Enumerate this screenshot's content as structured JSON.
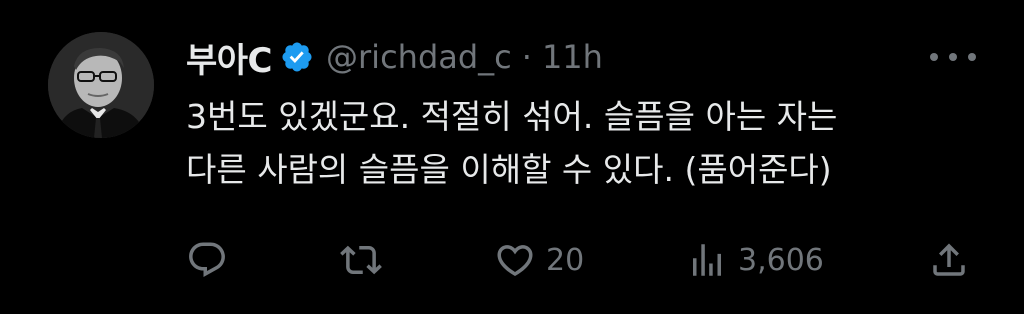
{
  "tweet": {
    "author": {
      "display_name": "부아C",
      "verified": true,
      "handle": "@richdad_c"
    },
    "separator": "·",
    "time": "11h",
    "text_lines": [
      "3번도 있겠군요. 적절히 섞어. 슬픔을 아는 자는",
      "다른 사람의 슬픔을 이해할 수 있다. (품어준다)"
    ],
    "actions": {
      "reply_count": "",
      "retweet_count": "",
      "like_count": "20",
      "views_count": "3,606"
    }
  },
  "colors": {
    "background": "#000000",
    "text": "#e7e9ea",
    "secondary": "#71767b",
    "verified_badge": "#1d9bf0"
  },
  "icons": [
    "more-icon",
    "verified-badge-icon",
    "reply-icon",
    "retweet-icon",
    "like-icon",
    "views-icon",
    "share-icon"
  ]
}
